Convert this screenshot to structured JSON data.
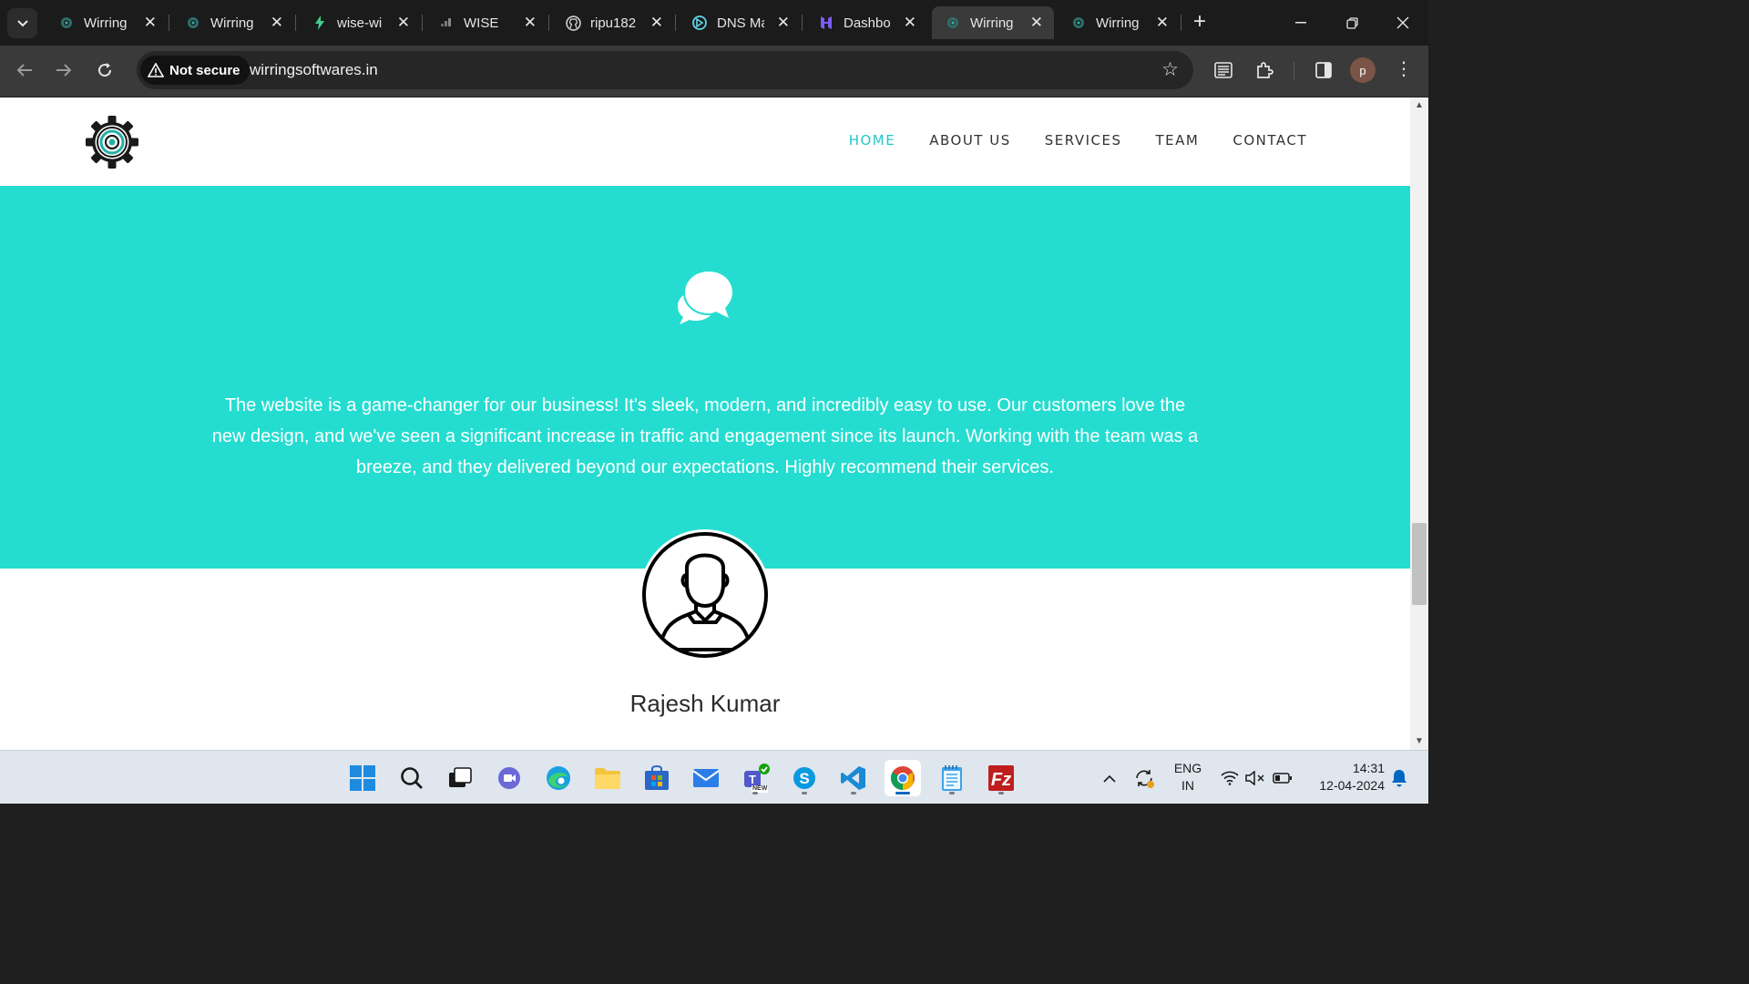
{
  "browser": {
    "tabs": [
      {
        "title": "Wirring",
        "favicon": "gear-favicon"
      },
      {
        "title": "Wirring",
        "favicon": "gear-favicon"
      },
      {
        "title": "wise-wi",
        "favicon": "bolt-favicon"
      },
      {
        "title": "WISE",
        "favicon": "wise-favicon"
      },
      {
        "title": "ripu182",
        "favicon": "github-favicon"
      },
      {
        "title": "DNS Ma",
        "favicon": "dns-favicon"
      },
      {
        "title": "Dashbo",
        "favicon": "hostinger-favicon"
      },
      {
        "title": "Wirring",
        "favicon": "gear-favicon",
        "active": true
      },
      {
        "title": "Wirring",
        "favicon": "gear-favicon"
      }
    ],
    "security_label": "Not secure",
    "url": "wirringsoftwares.in",
    "profile_initial": "p"
  },
  "site": {
    "nav": [
      "HOME",
      "ABOUT US",
      "SERVICES",
      "TEAM",
      "CONTACT"
    ],
    "active_nav": "HOME",
    "testimonial": "The website is a game-changer for our business! It's sleek, modern, and incredibly easy to use. Our customers love the new design, and we've seen a significant increase in traffic and engagement since its launch. Working with the team was a breeze, and they delivered beyond our expectations. Highly recommend their services.",
    "person_name": "Rajesh Kumar",
    "accent_color": "#24ddd0",
    "nav_active_color": "#25c7c7"
  },
  "taskbar": {
    "language": "ENG",
    "region": "IN",
    "time": "14:31",
    "date": "12-04-2024",
    "teams_badge": "NEW"
  }
}
